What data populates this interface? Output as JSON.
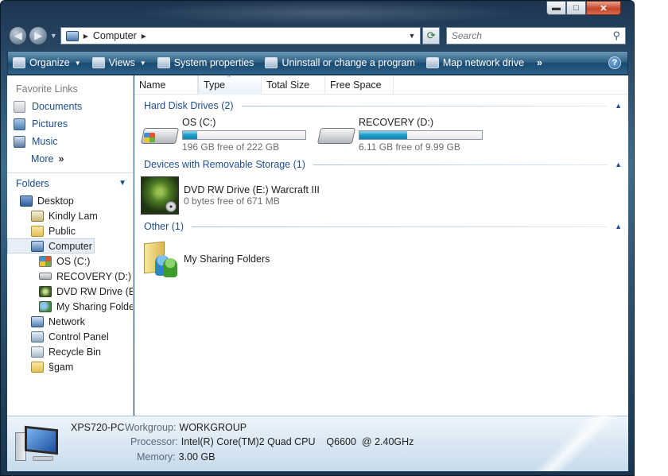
{
  "window": {
    "caption_buttons": {
      "minimize": "▬",
      "maximize": "□",
      "close": "✕"
    }
  },
  "navigation": {
    "back_icon": "back-arrow-icon",
    "forward_icon": "forward-arrow-icon",
    "address_path": "Computer",
    "search_placeholder": "Search"
  },
  "toolbar": {
    "organize": "Organize",
    "views": "Views",
    "system_properties": "System properties",
    "uninstall": "Uninstall or change a program",
    "map_drive": "Map network drive",
    "more": "»",
    "help": "?"
  },
  "favorites": {
    "title": "Favorite Links",
    "items": [
      {
        "label": "Documents",
        "icon": "documents-icon"
      },
      {
        "label": "Pictures",
        "icon": "pictures-icon"
      },
      {
        "label": "Music",
        "icon": "music-icon"
      }
    ],
    "more": "More",
    "more_chevron": "»"
  },
  "folders": {
    "title": "Folders",
    "tree": [
      {
        "label": "Desktop",
        "icon": "desktop-icon",
        "level": 1
      },
      {
        "label": "Kindly Lam",
        "icon": "user-folder-icon",
        "level": 2
      },
      {
        "label": "Public",
        "icon": "folder-icon",
        "level": 2
      },
      {
        "label": "Computer",
        "icon": "computer-icon",
        "level": 2,
        "selected": true
      },
      {
        "label": "OS (C:)",
        "icon": "windows-drive-icon",
        "level": 3
      },
      {
        "label": "RECOVERY (D:)",
        "icon": "drive-icon",
        "level": 3
      },
      {
        "label": "DVD RW Drive (E:)",
        "icon": "dvd-drive-icon",
        "level": 3
      },
      {
        "label": "My Sharing Folders",
        "icon": "sharing-folders-icon",
        "level": 3
      },
      {
        "label": "Network",
        "icon": "network-icon",
        "level": 2
      },
      {
        "label": "Control Panel",
        "icon": "control-panel-icon",
        "level": 2
      },
      {
        "label": "Recycle Bin",
        "icon": "recycle-bin-icon",
        "level": 2
      },
      {
        "label": "§gam",
        "icon": "folder-icon",
        "level": 2
      }
    ]
  },
  "columns": [
    "Name",
    "Type",
    "Total Size",
    "Free Space"
  ],
  "groups": {
    "hard_disks": {
      "title": "Hard Disk Drives (2)",
      "drives": [
        {
          "name": "OS (C:)",
          "free_text": "196 GB free of 222 GB",
          "used_fraction": 0.12,
          "icon": "windows-drive-icon"
        },
        {
          "name": "RECOVERY (D:)",
          "free_text": "6.11 GB free of 9.99 GB",
          "used_fraction": 0.39,
          "icon": "drive-icon"
        }
      ]
    },
    "removable": {
      "title": "Devices with Removable Storage (1)",
      "device": {
        "name": "DVD RW Drive (E:) Warcraft III",
        "free_text": "0 bytes free of 671 MB",
        "icon": "dvd-drive-icon"
      }
    },
    "other": {
      "title": "Other (1)",
      "item": {
        "name": "My Sharing Folders",
        "icon": "sharing-folders-icon"
      }
    }
  },
  "details": {
    "pc_name": "XPS720-PC",
    "workgroup_label": "Workgroup:",
    "workgroup": "WORKGROUP",
    "processor_label": "Processor:",
    "processor": "Intel(R) Core(TM)2 Quad CPU    Q6600  @ 2.40GHz",
    "memory_label": "Memory:",
    "memory": "3.00 GB"
  },
  "colors": {
    "link_blue": "#1a4d8a",
    "group_blue": "#1e4f8f",
    "bar_fill": "#1c9dc7"
  }
}
